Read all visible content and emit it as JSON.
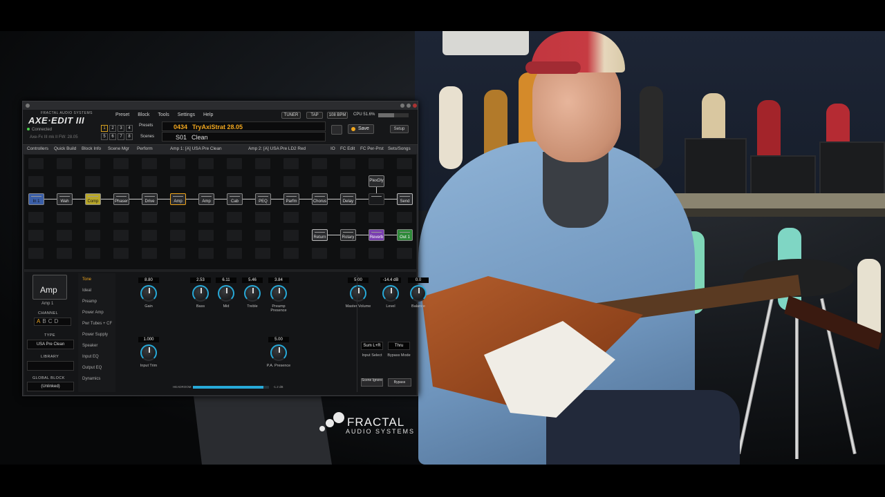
{
  "window": {
    "brand_small": "FRACTAL AUDIO SYSTEMS",
    "brand": "AXE·EDIT III",
    "connected": "Connected",
    "firmware": "Axe-Fx III mk II FW: 28.05"
  },
  "menu": [
    "Preset",
    "Block",
    "Tools",
    "Settings",
    "Help"
  ],
  "top_buttons": {
    "tuner": "TUNER",
    "tap": "TAP",
    "bpm": "108 BPM",
    "cpu": "CPU 51.6%"
  },
  "cpu_percent": 51.6,
  "number_buttons": [
    "1",
    "2",
    "3",
    "4",
    "5",
    "6",
    "7",
    "8"
  ],
  "active_number": "1",
  "presets_label": "Presets",
  "scenes_label": "Scenes",
  "preset": {
    "number": "0434",
    "name": "TryAxiStrat 28.05"
  },
  "scene": {
    "number": "S01",
    "name": "Clean"
  },
  "save_label": "Save",
  "setup_label": "Setup",
  "tabs": [
    "Controllers",
    "Quick Build",
    "Block Info",
    "Scene Mgr",
    "Perform",
    "Amp 1: [A] USA Pre Clean",
    "Amp 2: [A] USA Pre LD2 Red",
    "IO",
    "FC Edit",
    "FC Per-Prst",
    "Sets/Songs"
  ],
  "blocks_row": [
    "In 1",
    "Wah",
    "Comp",
    "Phaser",
    "Drive",
    "Amp",
    "Amp",
    "Cab",
    "PEQ",
    "Parfm",
    "Chorus",
    "Delay",
    "",
    "Send"
  ],
  "block_row_top": "PlexDly",
  "blocks_row2": [
    "Return",
    "Rotary",
    "Reverb",
    "Out 1"
  ],
  "editor": {
    "block_title": "Amp",
    "block_sub": "Amp 1",
    "channel_label": "CHANNEL",
    "channels": [
      "A",
      "B",
      "C",
      "D"
    ],
    "active_channel": "A",
    "type_label": "TYPE",
    "type_value": "USA Pre Clean",
    "library_label": "LIBRARY",
    "global_label": "GLOBAL BLOCK",
    "global_value": "(Unlinked)",
    "pages": [
      "Tone",
      "Ideal",
      "Preamp",
      "Power Amp",
      "Pwr Tubes + CF",
      "Power Supply",
      "Speaker",
      "Input EQ",
      "Output EQ",
      "Dynamics"
    ],
    "active_page": "Tone",
    "knobs": [
      {
        "label": "Gain",
        "value": "8.80"
      },
      {
        "label": "Bass",
        "value": "2.53"
      },
      {
        "label": "Mid",
        "value": "6.11"
      },
      {
        "label": "Treble",
        "value": "5.46"
      },
      {
        "label": "Preamp Presence",
        "value": "3.84"
      },
      {
        "label": "Master Volume",
        "value": "5.00"
      },
      {
        "label": "Level",
        "value": "-14.4 dB"
      },
      {
        "label": "Balance",
        "value": "0.0"
      },
      {
        "label": "Input Trim",
        "value": "1.000"
      },
      {
        "label": "P.A. Presence",
        "value": "5.00"
      }
    ],
    "input_select": {
      "value": "Sum L+R",
      "label": "Input Select"
    },
    "bypass_mode": {
      "value": "Thru",
      "label": "Bypass Mode"
    },
    "scene_ignore": "Scene Ignore",
    "bypass": "Bypass",
    "headroom_label": "HEADROOM",
    "headroom_value": "-1.2 dB",
    "headroom_fraction": 0.93
  },
  "overlay_logo": {
    "line1": "FRACTAL",
    "line2": "AUDIO SYSTEMS"
  },
  "colors": {
    "accent": "#f2a71e",
    "knob_ring": "#27a9d8",
    "reverb_block": "#7a3fb0",
    "out_block": "#2f8a3a",
    "in_block": "#3b5fa8",
    "comp_block": "#b8a72a"
  }
}
